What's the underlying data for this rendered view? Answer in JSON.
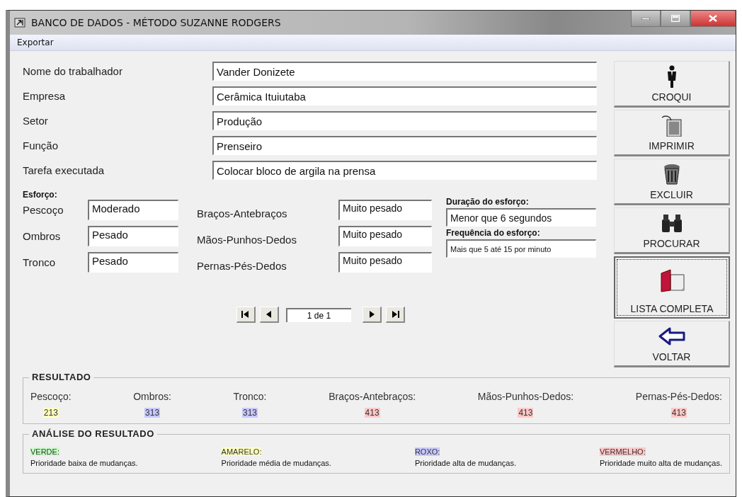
{
  "window": {
    "title": "BANCO DE DADOS - MÉTODO SUZANNE RODGERS"
  },
  "menu": [
    {
      "label": "Exportar"
    }
  ],
  "fields": [
    {
      "label": "Nome do trabalhador",
      "value": "Vander Donizete"
    },
    {
      "label": "Empresa",
      "value": "Cerâmica Ituiutaba"
    },
    {
      "label": "Setor",
      "value": "Produção"
    },
    {
      "label": "Função",
      "value": "Prenseiro"
    },
    {
      "label": "Tarefa executada",
      "value": "Colocar bloco de argila na prensa"
    }
  ],
  "effort": {
    "title": "Esforço:",
    "left": [
      {
        "label": "Pescoço",
        "value": "Moderado"
      },
      {
        "label": "Ombros",
        "value": "Pesado"
      },
      {
        "label": "Tronco",
        "value": "Pesado"
      }
    ],
    "middle": [
      {
        "label": "Braços-Antebraços",
        "value": "Muito pesado"
      },
      {
        "label": "Mãos-Punhos-Dedos",
        "value": "Muito pesado"
      },
      {
        "label": "Pernas-Pés-Dedos",
        "value": "Muito pesado"
      }
    ],
    "duration": {
      "label": "Duração do esforço:",
      "value": "Menor que 6 segundos"
    },
    "frequency": {
      "label": "Frequência do esforço:",
      "value": "Mais que 5 até 15 por minuto"
    }
  },
  "navigator": {
    "position": "1 de 1",
    "buttons": [
      {
        "kind": "first"
      },
      {
        "kind": "prev"
      },
      {
        "kind": "next"
      },
      {
        "kind": "last"
      }
    ]
  },
  "actions": [
    {
      "kind": "person",
      "label": "CROQUI",
      "focused": false
    },
    {
      "kind": "print",
      "label": "IMPRIMIR",
      "focused": false
    },
    {
      "kind": "trash",
      "label": "EXCLUIR",
      "focused": false
    },
    {
      "kind": "binoculars",
      "label": "PROCURAR",
      "focused": false
    },
    {
      "kind": "book",
      "label": "LISTA COMPLETA",
      "focused": true
    },
    {
      "kind": "back",
      "label": "VOLTAR",
      "focused": false
    }
  ],
  "result": {
    "title": "RESULTADO",
    "items": [
      {
        "label": "Pescoço:",
        "value": "213",
        "color": "#ffffc0"
      },
      {
        "label": "Ombros:",
        "value": "313",
        "color": "#c8c8ff"
      },
      {
        "label": "Tronco:",
        "value": "313",
        "color": "#c8c8ff"
      },
      {
        "label": "Braços-Antebraços:",
        "value": "413",
        "color": "#ffc8c8"
      },
      {
        "label": "Mãos-Punhos-Dedos:",
        "value": "413",
        "color": "#ffc8c8"
      },
      {
        "label": "Pernas-Pés-Dedos:",
        "value": "413",
        "color": "#ffc8c8"
      }
    ]
  },
  "analysis": {
    "title": "ANÁLISE DO RESULTADO",
    "items": [
      {
        "name": "VERDE:",
        "text": "Prioridade baixa de mudanças.",
        "color": "#c8ffc8"
      },
      {
        "name": "AMARELO:",
        "text": "Prioridade média de mudanças.",
        "color": "#ffffc0"
      },
      {
        "name": "ROXO:",
        "text": "Prioridade alta de mudanças.",
        "color": "#c8c8ff"
      },
      {
        "name": "VERMELHO:",
        "text": "Prioridade muito alta de mudanças.",
        "color": "#ffc8c8"
      }
    ]
  }
}
